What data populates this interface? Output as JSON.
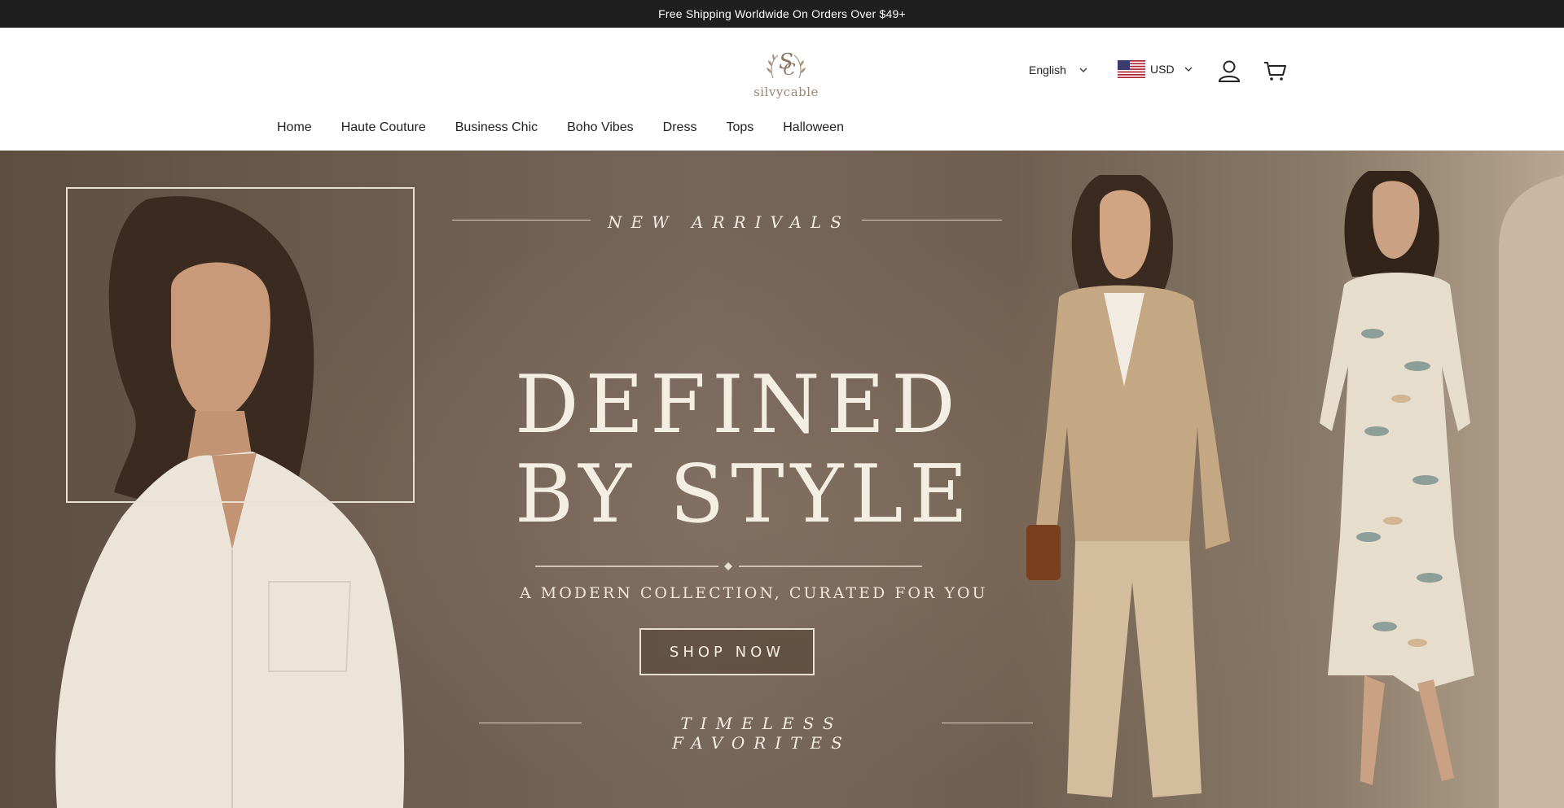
{
  "announcement": {
    "text": "Free Shipping Worldwide On Orders Over $49+"
  },
  "brand": {
    "logo_text": "silvycable",
    "monogram": "SC"
  },
  "header": {
    "language": {
      "selected": "English"
    },
    "currency": {
      "selected": "USD",
      "flag": "us-flag-icon"
    },
    "icons": {
      "account": "user-icon",
      "cart": "cart-icon"
    }
  },
  "nav": {
    "items": [
      {
        "label": "Home"
      },
      {
        "label": "Haute Couture"
      },
      {
        "label": "Business Chic"
      },
      {
        "label": "Boho Vibes"
      },
      {
        "label": "Dress"
      },
      {
        "label": "Tops"
      },
      {
        "label": "Halloween"
      }
    ]
  },
  "hero": {
    "eyebrow": "NEW ARRIVALS",
    "headline_line1": "DEFINED",
    "headline_line2": "BY STYLE",
    "subheading": "A MODERN COLLECTION, CURATED FOR YOU",
    "cta_label": "SHOP NOW",
    "footer_tag": "TIMELESS FAVORITES"
  },
  "colors": {
    "announcement_bg": "#1f1f1f",
    "hero_bg": "#6a5a4b",
    "hero_text": "#f4ede2",
    "logo": "#9a8572"
  }
}
